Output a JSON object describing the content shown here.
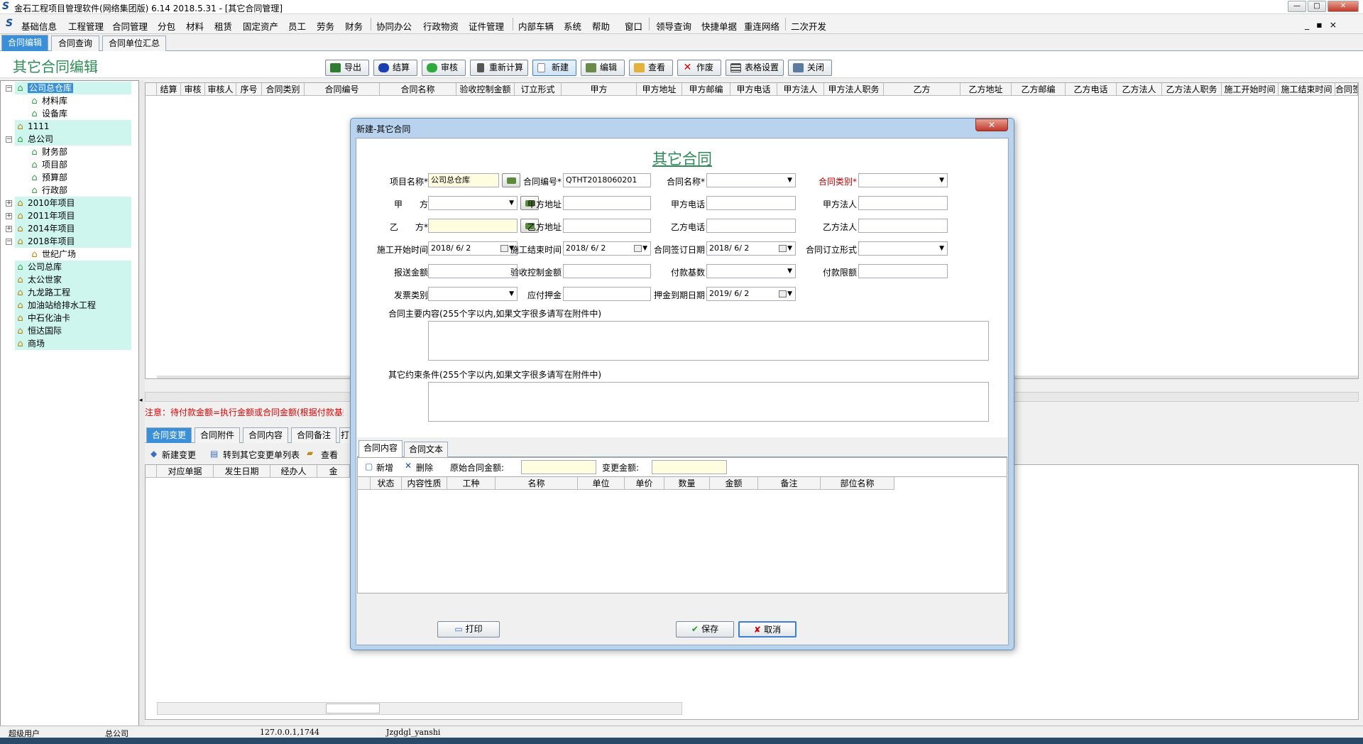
{
  "window": {
    "title": "金石工程项目管理软件(网络集团版) 6.14  2018.5.31 - [其它合同管理]",
    "btn_min": "—",
    "btn_max": "□",
    "btn_close": "✕"
  },
  "menu": {
    "items": [
      "基础信息",
      "工程管理",
      "合同管理",
      "分包",
      "材料",
      "租赁",
      "固定资产",
      "员工",
      "劳务",
      "财务",
      "协同办公",
      "行政物资",
      "证件管理",
      "内部车辆",
      "系统",
      "帮助",
      "窗口",
      "领导查询",
      "快捷单据",
      "重连网络",
      "二次开发"
    ],
    "controls": "_ ▪ ×"
  },
  "tabs": [
    "合同编辑",
    "合同查询",
    "合同单位汇总"
  ],
  "page_title": "其它合同编辑",
  "toolbar": {
    "export": "导出",
    "settle": "结算",
    "audit": "审核",
    "recalc": "重新计算",
    "new": "新建",
    "edit": "编辑",
    "view": "查看",
    "void": "作废",
    "grid_settings": "表格设置",
    "close": "关闭"
  },
  "tree": {
    "n0": "公司总仓库",
    "n1": "材料库",
    "n2": "设备库",
    "n3": "1111",
    "n4": "总公司",
    "n5": "财务部",
    "n6": "项目部",
    "n7": "预算部",
    "n8": "行政部",
    "n9": "2010年项目",
    "n10": "2011年项目",
    "n11": "2014年项目",
    "n12": "2018年项目",
    "n13": "世纪广场",
    "n14": "公司总库",
    "n15": "太公世家",
    "n16": "九龙路工程",
    "n17": "加油站给排水工程",
    "n18": "中石化油卡",
    "n19": "恒达国际",
    "n20": "商场"
  },
  "grid": {
    "headers": [
      "结算",
      "审核",
      "审核人",
      "序号",
      "合同类别",
      "合同编号",
      "合同名称",
      "验收控制金额",
      "订立形式",
      "甲方",
      "甲方地址",
      "甲方邮编",
      "甲方电话",
      "甲方法人",
      "甲方法人职务",
      "乙方",
      "乙方地址",
      "乙方邮编",
      "乙方电话",
      "乙方法人",
      "乙方法人职务",
      "施工开始时间",
      "施工结束时间",
      "合同签"
    ]
  },
  "note": "注意：待付款金额=执行金额或合同金额(根据付款基数)",
  "lower": {
    "tabs": [
      "合同变更",
      "合同附件",
      "合同内容",
      "合同备注",
      "打"
    ],
    "new_change": "新建变更",
    "to_list": "转到其它变更单列表",
    "view": "查看",
    "headers": [
      "对应单据",
      "发生日期",
      "经办人",
      "金"
    ]
  },
  "status": {
    "user": "超级用户",
    "company": "总公司",
    "ip": "127.0.0.1,1744",
    "db": "Jzgdgl_yanshi"
  },
  "dialog": {
    "title": "新建-其它合同",
    "heading": "其它合同",
    "labels": {
      "proj_name": "项目名称*",
      "contract_no": "合同编号*",
      "contract_name": "合同名称*",
      "contract_type": "合同类别*",
      "party_a": "甲　　方",
      "a_addr": "甲方地址",
      "a_tel": "甲方电话",
      "a_legal": "甲方法人",
      "party_b": "乙　　方*",
      "b_addr": "乙方地址",
      "b_tel": "乙方电话",
      "b_legal": "乙方法人",
      "start": "施工开始时间",
      "end": "施工结束时间",
      "sign": "合同签订日期",
      "form": "合同订立形式",
      "report_amt": "报送金额",
      "ctrl_amt": "验收控制金额",
      "pay_base": "付款基数",
      "pay_limit": "付款限额",
      "invoice": "发票类别",
      "deposit": "应付押金",
      "deposit_due": "押金到期日期",
      "main_content": "合同主要内容(255个字以内,如果文字很多请写在附件中)",
      "other_terms": "其它约束条件(255个字以内,如果文字很多请写在附件中)"
    },
    "values": {
      "proj_name": "公司总仓库",
      "contract_no": "QTHT2018060201",
      "start": "2018/ 6/ 2",
      "end": "2018/ 6/ 2",
      "sign": "2018/ 6/ 2",
      "deposit_due": "2019/ 6/ 2"
    },
    "tabs": [
      "合同内容",
      "合同文本"
    ],
    "panel": {
      "add": "新增",
      "delete": "删除",
      "orig_amt": "原始合同金额:",
      "change_amt": "变更金额:",
      "headers": [
        "状态",
        "内容性质",
        "工种",
        "名称",
        "单位",
        "单价",
        "数量",
        "金额",
        "备注",
        "部位名称"
      ]
    },
    "buttons": {
      "print": "打印",
      "save": "保存",
      "cancel": "取消"
    },
    "close": "✕"
  }
}
